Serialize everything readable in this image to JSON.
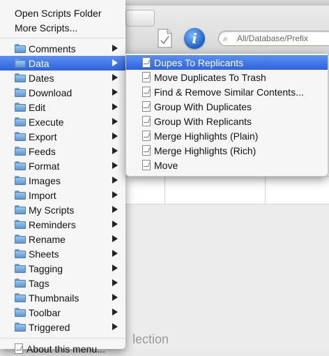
{
  "background": {
    "search_placeholder": "All/Database/Prefix",
    "selection_text": "lection",
    "info_glyph": "i"
  },
  "main_menu": {
    "top_items": [
      "Open Scripts Folder",
      "More Scripts..."
    ],
    "folders": [
      {
        "label": "Comments"
      },
      {
        "label": "Data",
        "selected": true
      },
      {
        "label": "Dates"
      },
      {
        "label": "Download"
      },
      {
        "label": "Edit"
      },
      {
        "label": "Execute"
      },
      {
        "label": "Export"
      },
      {
        "label": "Feeds"
      },
      {
        "label": "Format"
      },
      {
        "label": "Images"
      },
      {
        "label": "Import"
      },
      {
        "label": "My Scripts"
      },
      {
        "label": "Reminders"
      },
      {
        "label": "Rename"
      },
      {
        "label": "Sheets"
      },
      {
        "label": "Tagging"
      },
      {
        "label": "Tags"
      },
      {
        "label": "Thumbnails"
      },
      {
        "label": "Toolbar"
      },
      {
        "label": "Triggered"
      }
    ],
    "bottom_item": "About this menu..."
  },
  "sub_menu": {
    "items": [
      {
        "label": "Dupes To Replicants",
        "selected": true
      },
      {
        "label": "Move Duplicates To Trash"
      },
      {
        "label": "Find & Remove Similar Contents..."
      },
      {
        "label": "Group With Duplicates"
      },
      {
        "label": "Group With Replicants"
      },
      {
        "label": "Merge Highlights (Plain)"
      },
      {
        "label": "Merge Highlights (Rich)"
      },
      {
        "label": "Move"
      }
    ]
  },
  "colors": {
    "selection": "#3a70e2",
    "folder": "#7aaee3"
  }
}
